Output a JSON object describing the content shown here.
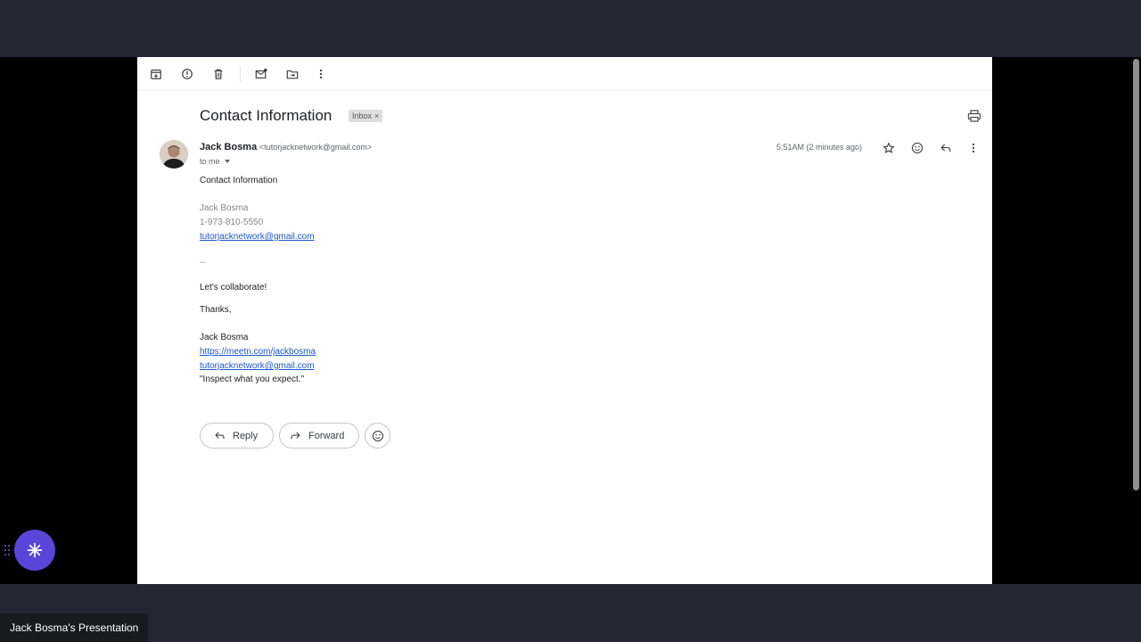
{
  "colors": {
    "chrome_bg": "#222733",
    "stage_bg": "#000000",
    "link": "#1a57c9",
    "badge": "#5b45d8"
  },
  "presenter": {
    "label": "Jack Bosma's Presentation"
  },
  "toolbar": {
    "icons": [
      "archive-icon",
      "report-spam-icon",
      "delete-icon",
      "mark-unread-icon",
      "move-to-icon",
      "more-vert-icon"
    ]
  },
  "email": {
    "subject": "Contact Information",
    "label_chip": "Inbox",
    "label_chip_close": "×",
    "sender_name": "Jack Bosma",
    "sender_email": "<tutorjacknetwork@gmail.com>",
    "recipient": "to me",
    "timestamp": "5:51AM (2 minutes ago)",
    "body": {
      "heading": "Contact Information",
      "contact_name": "Jack Bosma",
      "contact_phone": "1-973-810-5550",
      "contact_email": "tutorjacknetwork@gmail.com",
      "separator": "--",
      "message": "Let's collaborate!",
      "closing": "Thanks,",
      "signature_name": "Jack Bosma",
      "signature_url": "https://meetn.com/jackbosma",
      "signature_email": "tutorjacknetwork@gmail.com",
      "signature_quote": "\"Inspect what you expect.\""
    },
    "actions": {
      "reply": "Reply",
      "forward": "Forward"
    }
  }
}
